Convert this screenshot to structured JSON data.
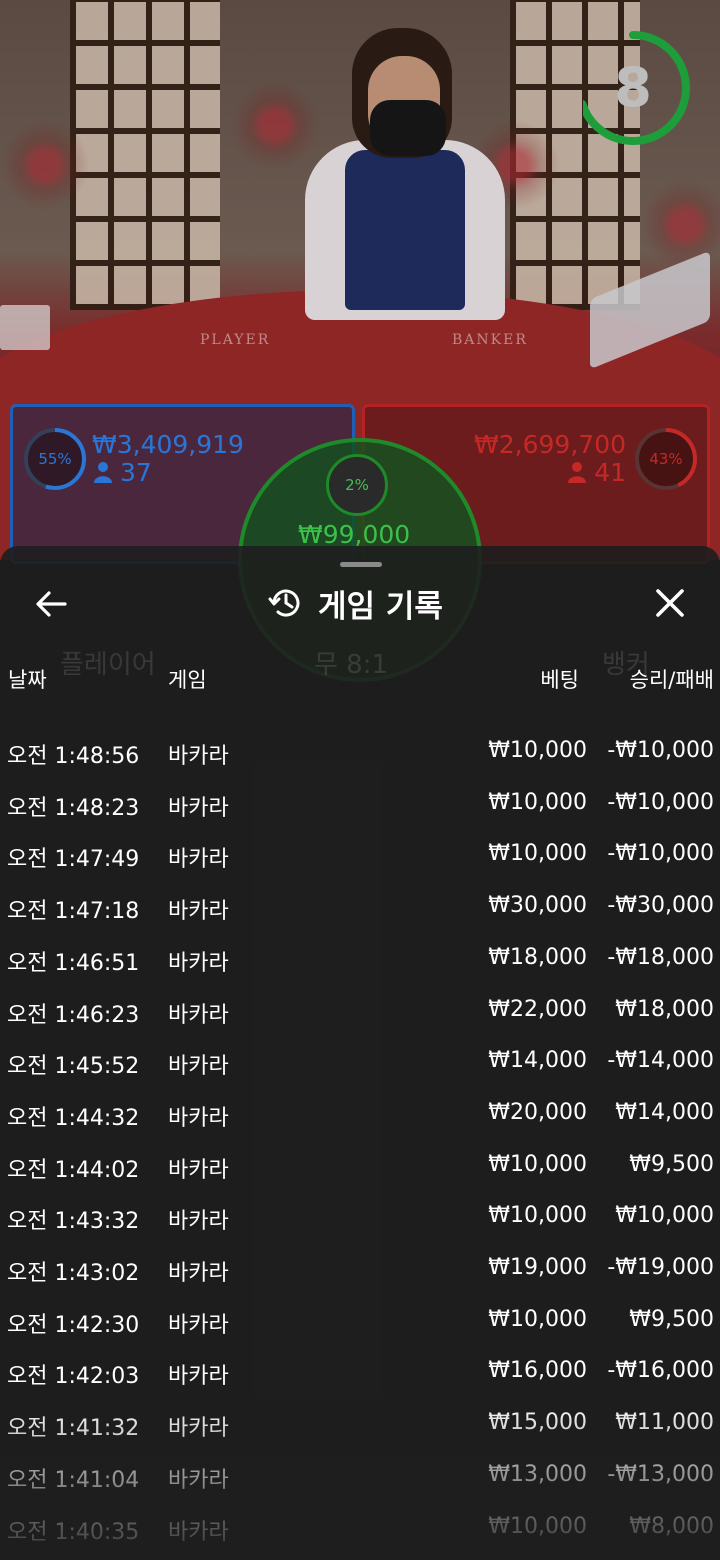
{
  "timer": {
    "value": "8",
    "progress": 0.7,
    "color": "#1e9e3a"
  },
  "table": {
    "player_label": "PLAYER",
    "banker_label": "BANKER"
  },
  "bets": {
    "player": {
      "percent": "55%",
      "amount": "₩3,409,919",
      "count": "37",
      "color": "#2a76d6"
    },
    "banker": {
      "percent": "43%",
      "amount": "₩2,699,700",
      "count": "41",
      "color": "#c62828"
    },
    "tie": {
      "percent": "2%",
      "amount": "₩99,000",
      "color": "#3bc04a"
    }
  },
  "background_ui": {
    "player": "플레이어",
    "tie_odds": "무 8:1",
    "banker": "뱅커"
  },
  "panel": {
    "title": "게임 기록",
    "icons": {
      "back": "back-arrow-icon",
      "history": "history-icon",
      "close": "close-icon"
    },
    "columns": {
      "date": "날짜",
      "game": "게임",
      "bet": "베팅",
      "win_loss": "승리/패배"
    },
    "rows": [
      {
        "time": "오전 1:48:56",
        "game": "바카라",
        "bet": "₩10,000",
        "result": "-₩10,000"
      },
      {
        "time": "오전 1:48:23",
        "game": "바카라",
        "bet": "₩10,000",
        "result": "-₩10,000"
      },
      {
        "time": "오전 1:47:49",
        "game": "바카라",
        "bet": "₩10,000",
        "result": "-₩10,000"
      },
      {
        "time": "오전 1:47:18",
        "game": "바카라",
        "bet": "₩30,000",
        "result": "-₩30,000"
      },
      {
        "time": "오전 1:46:51",
        "game": "바카라",
        "bet": "₩18,000",
        "result": "-₩18,000"
      },
      {
        "time": "오전 1:46:23",
        "game": "바카라",
        "bet": "₩22,000",
        "result": "₩18,000"
      },
      {
        "time": "오전 1:45:52",
        "game": "바카라",
        "bet": "₩14,000",
        "result": "-₩14,000"
      },
      {
        "time": "오전 1:44:32",
        "game": "바카라",
        "bet": "₩20,000",
        "result": "₩14,000"
      },
      {
        "time": "오전 1:44:02",
        "game": "바카라",
        "bet": "₩10,000",
        "result": "₩9,500"
      },
      {
        "time": "오전 1:43:32",
        "game": "바카라",
        "bet": "₩10,000",
        "result": "₩10,000"
      },
      {
        "time": "오전 1:43:02",
        "game": "바카라",
        "bet": "₩19,000",
        "result": "-₩19,000"
      },
      {
        "time": "오전 1:42:30",
        "game": "바카라",
        "bet": "₩10,000",
        "result": "₩9,500"
      },
      {
        "time": "오전 1:42:03",
        "game": "바카라",
        "bet": "₩16,000",
        "result": "-₩16,000"
      },
      {
        "time": "오전 1:41:32",
        "game": "바카라",
        "bet": "₩15,000",
        "result": "₩11,000"
      },
      {
        "time": "오전 1:41:04",
        "game": "바카라",
        "bet": "₩13,000",
        "result": "-₩13,000"
      },
      {
        "time": "오전 1:40:35",
        "game": "바카라",
        "bet": "₩10,000",
        "result": "₩8,000"
      }
    ]
  }
}
